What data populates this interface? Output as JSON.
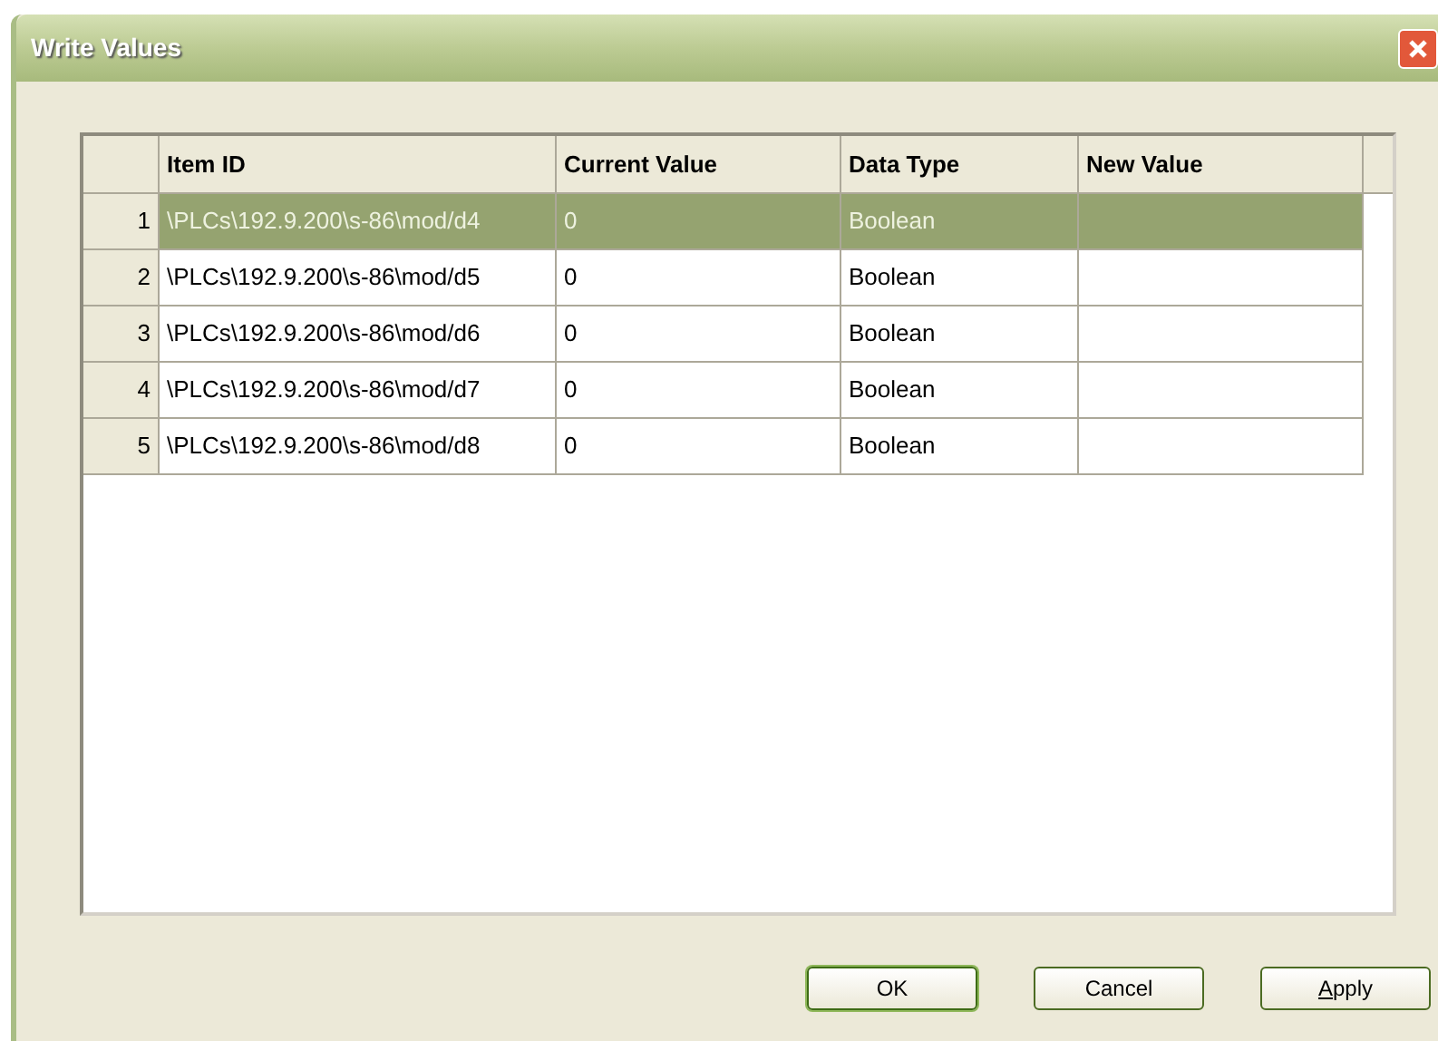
{
  "window": {
    "title": "Write Values"
  },
  "table": {
    "columns": [
      "Item ID",
      "Current Value",
      "Data Type",
      "New Value"
    ],
    "rows": [
      {
        "number": "1",
        "item_id": "\\PLCs\\192.9.200\\s-86\\mod/d4",
        "current_value": "0",
        "data_type": "Boolean",
        "selected": true
      },
      {
        "number": "2",
        "item_id": "\\PLCs\\192.9.200\\s-86\\mod/d5",
        "current_value": "0",
        "data_type": "Boolean",
        "selected": false
      },
      {
        "number": "3",
        "item_id": "\\PLCs\\192.9.200\\s-86\\mod/d6",
        "current_value": "0",
        "data_type": "Boolean",
        "selected": false
      },
      {
        "number": "4",
        "item_id": "\\PLCs\\192.9.200\\s-86\\mod/d7",
        "current_value": "0",
        "data_type": "Boolean",
        "selected": false
      },
      {
        "number": "5",
        "item_id": "\\PLCs\\192.9.200\\s-86\\mod/d8",
        "current_value": "0",
        "data_type": "Boolean",
        "selected": false
      }
    ]
  },
  "buttons": [
    {
      "label": "OK",
      "default": true,
      "kind": "plain"
    },
    {
      "label": "Cancel",
      "default": false,
      "kind": "plain"
    },
    {
      "label": "Apply",
      "default": false,
      "kind": "mnemonic"
    }
  ]
}
